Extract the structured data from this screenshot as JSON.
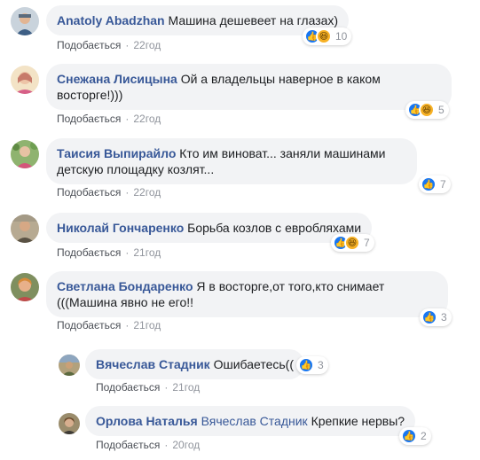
{
  "colors": {
    "author": "#385898",
    "bubble": "#f2f3f5",
    "meta": "#90949c",
    "like_blue": "#1877f2",
    "haha_yellow": "#f7b125"
  },
  "comments": [
    {
      "author": "Anatoly Abadzhan",
      "text": "Машина дешевеет на глазах)",
      "like_label": "Подобається",
      "time": "22год",
      "reactions": [
        "like-icon",
        "haha-icon"
      ],
      "reaction_count": "10"
    },
    {
      "author": "Снежана Лисицына",
      "text_line1": "Ой а владельцы наверное в каком",
      "text_line2": "восторге!)))",
      "like_label": "Подобається",
      "time": "22год",
      "reactions": [
        "like-icon",
        "haha-icon"
      ],
      "reaction_count": "5"
    },
    {
      "author": "Таисия Выпирайло",
      "text_line1": "Кто им виноват... заняли машинами",
      "text_line2": "детскую площадку козлят...",
      "like_label": "Подобається",
      "time": "22год",
      "reactions": [
        "like-icon"
      ],
      "reaction_count": "7"
    },
    {
      "author": "Николай Гончаренко",
      "text": "Борьба козлов с евробляхами",
      "like_label": "Подобається",
      "time": "21год",
      "reactions": [
        "like-icon",
        "haha-icon"
      ],
      "reaction_count": "7"
    },
    {
      "author": "Светлана Бондаренко",
      "text_line1": "Я в восторге,от того,кто снимает",
      "text_line2": "(((Машина явно не его!!",
      "like_label": "Подобається",
      "time": "21год",
      "reactions": [
        "like-icon"
      ],
      "reaction_count": "3"
    }
  ],
  "replies": [
    {
      "author": "Вячеслав Стадник",
      "text": "Ошибаетесь((",
      "like_label": "Подобається",
      "time": "21год",
      "reactions": [
        "like-icon"
      ],
      "reaction_count": "3"
    },
    {
      "author": "Орлова Наталья",
      "mention": "Вячеслав Стадник",
      "text": "Крепкие нервы?",
      "like_label": "Подобається",
      "time": "20год",
      "reactions": [
        "like-icon"
      ],
      "reaction_count": "2"
    }
  ]
}
